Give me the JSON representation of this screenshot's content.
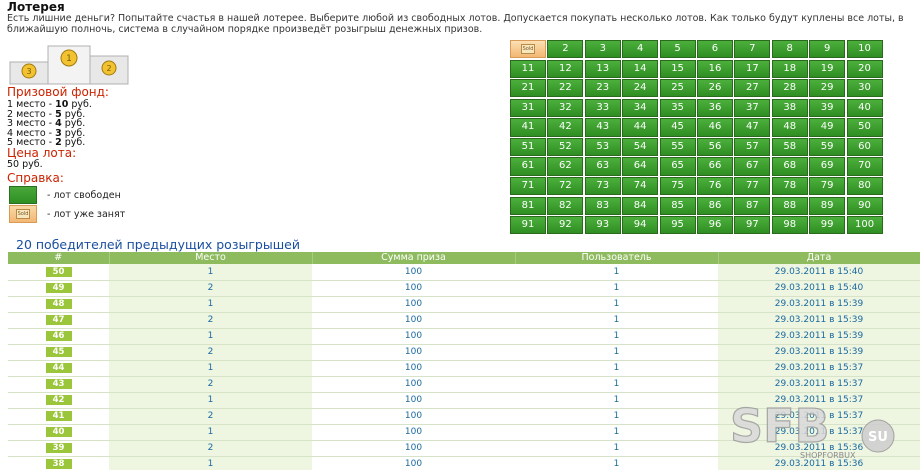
{
  "page": {
    "title": "Лотерея",
    "intro": "Есть лишние деньги? Попытайте счастья в нашей лотерее. Выберите любой из свободных лотов. Допускается покупать несколько лотов. Как только будут куплены все лоты, в ближайшую полночь, система в случайном порядке произведёт розыгрыш денежных призов."
  },
  "prize": {
    "heading": "Призовой фонд:",
    "places": [
      {
        "place": "1 место",
        "amount": "10",
        "unit": "руб."
      },
      {
        "place": "2 место",
        "amount": "5",
        "unit": "руб."
      },
      {
        "place": "3 место",
        "amount": "4",
        "unit": "руб."
      },
      {
        "place": "4 место",
        "amount": "3",
        "unit": "руб."
      },
      {
        "place": "5 место",
        "amount": "2",
        "unit": "руб."
      }
    ]
  },
  "price": {
    "heading": "Цена лота:",
    "value": "50 руб."
  },
  "help": {
    "heading": "Справка:",
    "free": "- лот свободен",
    "taken": "- лот уже занят",
    "taken_icon_text": "Sold"
  },
  "lots": {
    "total": 100,
    "taken": [
      1
    ]
  },
  "winners": {
    "heading": "20 победителей предыдущих розыгрышей",
    "columns": [
      "#",
      "Место",
      "Сумма приза",
      "Пользователь",
      "Дата"
    ],
    "rows": [
      {
        "num": "50",
        "place": "1",
        "sum": "100",
        "user": "1",
        "date": "29.03.2011 в 15:40"
      },
      {
        "num": "49",
        "place": "2",
        "sum": "100",
        "user": "1",
        "date": "29.03.2011 в 15:40"
      },
      {
        "num": "48",
        "place": "1",
        "sum": "100",
        "user": "1",
        "date": "29.03.2011 в 15:39"
      },
      {
        "num": "47",
        "place": "2",
        "sum": "100",
        "user": "1",
        "date": "29.03.2011 в 15:39"
      },
      {
        "num": "46",
        "place": "1",
        "sum": "100",
        "user": "1",
        "date": "29.03.2011 в 15:39"
      },
      {
        "num": "45",
        "place": "2",
        "sum": "100",
        "user": "1",
        "date": "29.03.2011 в 15:39"
      },
      {
        "num": "44",
        "place": "1",
        "sum": "100",
        "user": "1",
        "date": "29.03.2011 в 15:37"
      },
      {
        "num": "43",
        "place": "2",
        "sum": "100",
        "user": "1",
        "date": "29.03.2011 в 15:37"
      },
      {
        "num": "42",
        "place": "1",
        "sum": "100",
        "user": "1",
        "date": "29.03.2011 в 15:37"
      },
      {
        "num": "41",
        "place": "2",
        "sum": "100",
        "user": "1",
        "date": "29.03.2011 в 15:37"
      },
      {
        "num": "40",
        "place": "1",
        "sum": "100",
        "user": "1",
        "date": "29.03.2011 в 15:37"
      },
      {
        "num": "39",
        "place": "2",
        "sum": "100",
        "user": "1",
        "date": "29.03.2011 в 15:36"
      },
      {
        "num": "38",
        "place": "1",
        "sum": "100",
        "user": "1",
        "date": "29.03.2011 в 15:36"
      }
    ]
  },
  "watermark": {
    "text": "SFB",
    "suffix": "SU",
    "sub": "SHOPFORBUX"
  },
  "colors": {
    "lot_free": "#3a9c2c",
    "lot_taken": "#f2b774",
    "header_green": "#8fbb5f",
    "badge": "#9bc53a",
    "heading_red": "#cc2200",
    "link_blue": "#1a6aa0"
  }
}
